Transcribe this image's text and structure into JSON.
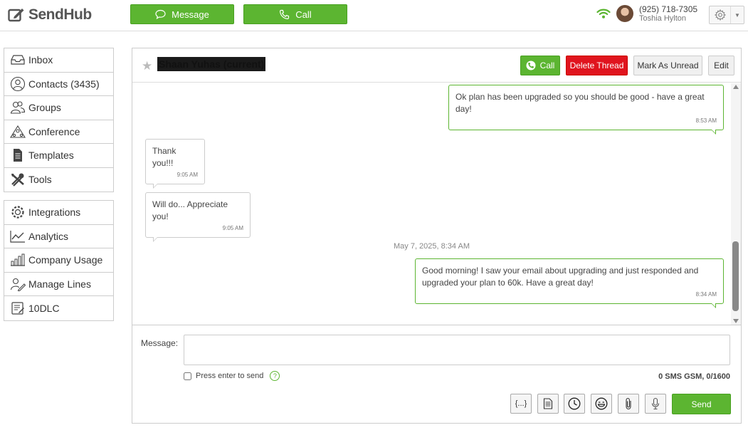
{
  "app": {
    "name": "SendHub"
  },
  "topbar": {
    "message_label": "Message",
    "call_label": "Call",
    "user_phone": "(925) 718-7305",
    "user_name": "Toshia Hylton"
  },
  "sidebar": {
    "group1": [
      {
        "label": "Inbox",
        "icon": "inbox-icon"
      },
      {
        "label": "Contacts (3435)",
        "icon": "contacts-icon"
      },
      {
        "label": "Groups",
        "icon": "groups-icon"
      },
      {
        "label": "Conference",
        "icon": "conference-icon"
      },
      {
        "label": "Templates",
        "icon": "templates-icon"
      },
      {
        "label": "Tools",
        "icon": "tools-icon"
      }
    ],
    "group2": [
      {
        "label": "Integrations",
        "icon": "integrations-icon"
      },
      {
        "label": "Analytics",
        "icon": "analytics-icon"
      },
      {
        "label": "Company Usage",
        "icon": "company-usage-icon"
      },
      {
        "label": "Manage Lines",
        "icon": "manage-lines-icon"
      },
      {
        "label": "10DLC",
        "icon": "10dlc-icon"
      }
    ]
  },
  "thread": {
    "contact_name": "Shaan Yuhas (current)",
    "call_label": "Call",
    "delete_label": "Delete Thread",
    "unread_label": "Mark As Unread",
    "edit_label": "Edit",
    "messages": [
      {
        "direction": "out",
        "text": "Ok plan has been upgraded so you should be good - have a great day!",
        "time": "8:53 AM"
      },
      {
        "direction": "in",
        "text": "Thank you!!!",
        "time": "9:05 AM"
      },
      {
        "direction": "in",
        "text": "Will do... Appreciate you!",
        "time": "9:05 AM"
      },
      {
        "direction": "out",
        "text": "Good morning! I saw your email about upgrading and just responded and upgraded your plan to 60k. Have a great day!",
        "time": "8:34 AM"
      }
    ],
    "date_separator": "May 7, 2025, 8:34 AM"
  },
  "composer": {
    "message_label": "Message:",
    "message_value": "",
    "enter_to_send_label": "Press enter to send",
    "help_symbol": "?",
    "sms_count": "0 SMS GSM, 0/1600",
    "template_tool_label": "{...}",
    "send_label": "Send"
  },
  "colors": {
    "accent_green": "#5cb531",
    "delete_red": "#e0141e"
  }
}
